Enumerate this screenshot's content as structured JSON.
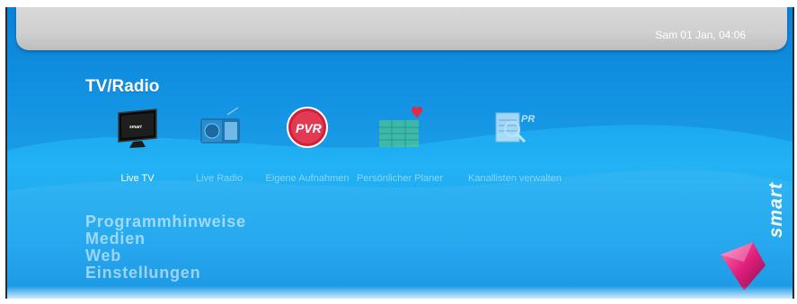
{
  "status_bar": {
    "datetime": "Sam 01 Jan, 04:06"
  },
  "section": {
    "title": "TV/Radio"
  },
  "tiles": [
    {
      "label": "Live TV",
      "icon": "tv-icon",
      "active": true
    },
    {
      "label": "Live Radio",
      "icon": "radio-icon",
      "active": false
    },
    {
      "label": "Eigene Aufnahmen",
      "icon": "pvr-icon",
      "icon_text": "PVR",
      "active": false
    },
    {
      "label": "Persönlicher Planer",
      "icon": "planner-icon",
      "active": false
    },
    {
      "label": "Kanallisten verwalten",
      "icon": "channel-list-icon",
      "icon_text": "PR",
      "active": false
    }
  ],
  "menu": [
    {
      "label": "Programmhinweise"
    },
    {
      "label": "Medien"
    },
    {
      "label": "Web"
    },
    {
      "label": "Einstellungen"
    }
  ],
  "brand": {
    "logo_text": "smart"
  },
  "colors": {
    "background": "#16a2ee",
    "topbar": "#cfcfcf",
    "pvr": "#d21f3a",
    "gem": "#e0207c"
  }
}
